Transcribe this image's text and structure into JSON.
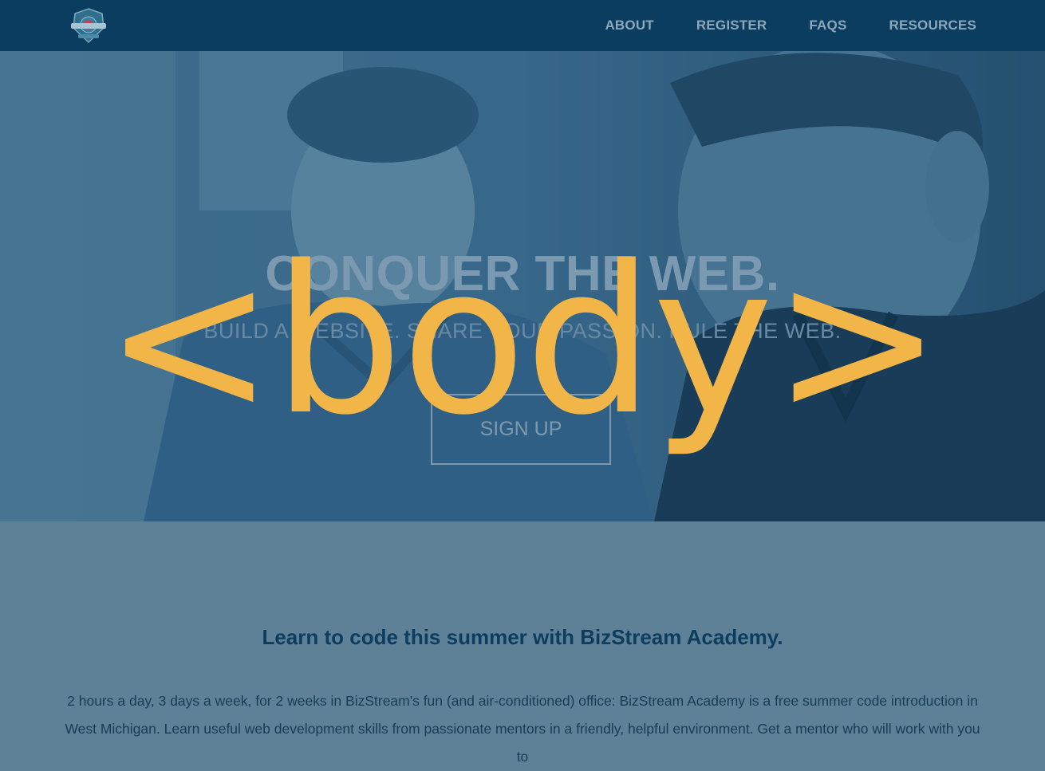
{
  "nav": {
    "logo_name": "bizstream-academy-logo",
    "links": [
      "ABOUT",
      "REGISTER",
      "FAQS",
      "RESOURCES"
    ]
  },
  "hero": {
    "title": "CONQUER THE WEB.",
    "subtitle": "BUILD A WEBSITE. SHARE YOUR PASSION. RULE THE WEB.",
    "signup_label": "SIGN UP"
  },
  "overlay": {
    "text": "<body>"
  },
  "intro": {
    "heading": "Learn to code this summer with BizStream Academy.",
    "text": "2 hours a day, 3 days a week, for 2 weeks in BizStream's fun (and air-conditioned) office: BizStream Academy is a free summer code introduction in West Michigan. Learn useful web development skills from passionate mentors in a friendly, helpful environment. Get a mentor who will work with you to"
  },
  "colors": {
    "navbar": "#0a3d5f",
    "hero_tint": "#2e5a7a",
    "accent": "#f2b548",
    "section_bg": "#5f8197",
    "heading": "#0c3d5e"
  }
}
